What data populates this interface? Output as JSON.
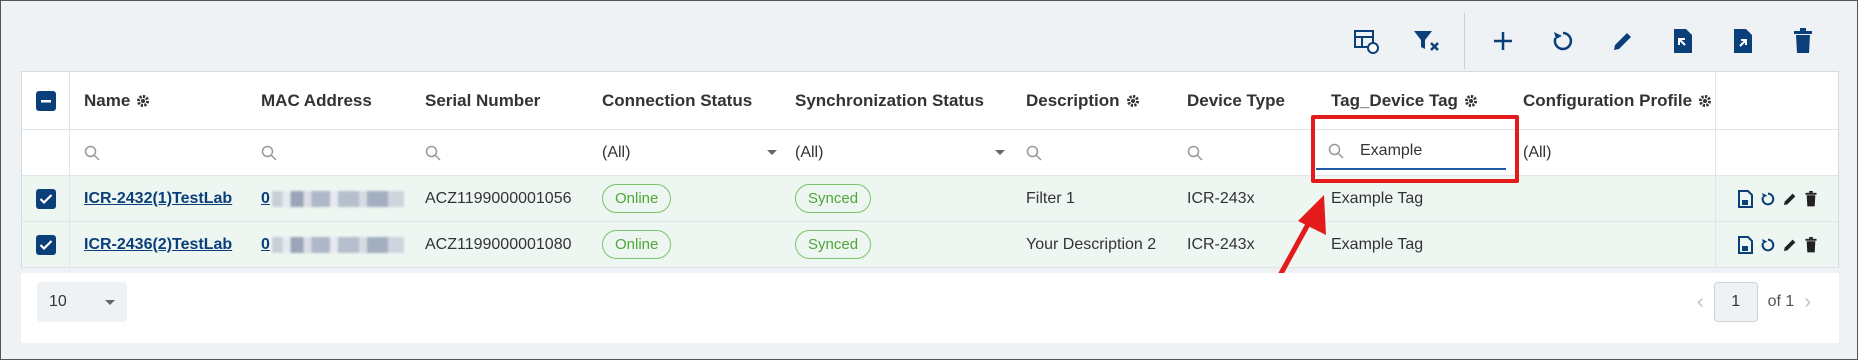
{
  "toolbar": {
    "buttons": [
      {
        "name": "column-chooser-icon"
      },
      {
        "name": "clear-filter-icon"
      },
      {
        "name": "add-icon"
      },
      {
        "name": "refresh-icon"
      },
      {
        "name": "edit-icon"
      },
      {
        "name": "import-icon"
      },
      {
        "name": "export-icon"
      },
      {
        "name": "delete-icon"
      }
    ]
  },
  "columns": [
    {
      "label": "Name"
    },
    {
      "label": "MAC Address"
    },
    {
      "label": "Serial Number"
    },
    {
      "label": "Connection Status"
    },
    {
      "label": "Synchronization Status"
    },
    {
      "label": "Description"
    },
    {
      "label": "Device Type"
    },
    {
      "label": "Tag_Device Tag"
    },
    {
      "label": "Configuration Profile"
    }
  ],
  "filters": {
    "connection_status": "(All)",
    "synchronization_status": "(All)",
    "tag_device_tag": "Example",
    "configuration_profile": "(All)"
  },
  "rows": [
    {
      "name": "ICR-2432(1)TestLab",
      "mac_prefix": "0",
      "serial": "ACZ1199000001056",
      "connection": "Online",
      "sync": "Synced",
      "description": "Filter 1",
      "device_type": "ICR-243x",
      "tag": "Example Tag",
      "profile": ""
    },
    {
      "name": "ICR-2436(2)TestLab",
      "mac_prefix": "0",
      "serial": "ACZ1199000001080",
      "connection": "Online",
      "sync": "Synced",
      "description": "Your Description 2",
      "device_type": "ICR-243x",
      "tag": "Example Tag",
      "profile": ""
    }
  ],
  "pager": {
    "page_size": "10",
    "current_page": "1",
    "of_label": "of 1"
  },
  "colors": {
    "accent": "#0b3f7a",
    "status_green": "#4fa53a",
    "highlight_red": "#e41b1b"
  }
}
